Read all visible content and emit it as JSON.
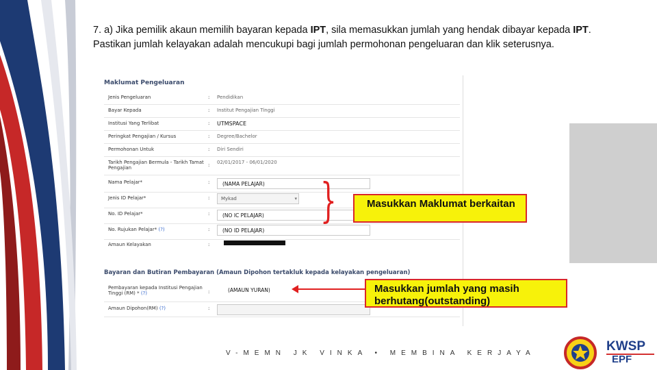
{
  "instruction": {
    "prefix": "7.  a) Jika pemilik akaun memilih bayaran kepada ",
    "b1": "IPT",
    "mid1": ", sila memasukkan jumlah yang hendak dibayar kepada ",
    "b2": "IPT",
    "suffix": ". Pastikan jumlah kelayakan adalah mencukupi bagi jumlah permohonan pengeluaran dan klik seterusnya."
  },
  "form": {
    "section1_title": "Maklumat Pengeluaran",
    "rows": [
      {
        "label": "Jenis Pengeluaran",
        "value": "Pendidikan"
      },
      {
        "label": "Bayar Kepada",
        "value": "Institut Pengajian Tinggi"
      },
      {
        "label": "Institusi Yang Terlibat",
        "value": "UTMSPACE"
      },
      {
        "label": "Peringkat Pengajian / Kursus",
        "value": "Degree/Bachelor"
      },
      {
        "label": "Permohonan Untuk",
        "value": "Diri Sendiri"
      },
      {
        "label": "Tarikh Pengajian Bermula - Tarikh Tamat Pengajian",
        "value": "02/01/2017 - 06/01/2020"
      },
      {
        "label": "Nama Pelajar*",
        "value": "(NAMA PELAJAR)"
      },
      {
        "label": "Jenis ID Pelajar*",
        "value": "Mykad"
      },
      {
        "label": "No. ID Pelajar*",
        "value": "(NO IC PELAJAR)"
      },
      {
        "label": "No. Rujukan Pelajar*",
        "help": "(?)",
        "value": "(NO ID PELAJAR)"
      },
      {
        "label": "Amaun Kelayakan",
        "value": ""
      }
    ],
    "section2_title": "Bayaran dan Butiran Pembayaran (Amaun Dipohon tertakluk kepada kelayakan pengeluaran)",
    "pay_rows": [
      {
        "label": "Pembayaran kepada Institusi Pengajian Tinggi (RM) *",
        "help": "(?)",
        "value": "(AMAUN YURAN)"
      },
      {
        "label": "Amaun Dipohon(RM)",
        "help": "(?)",
        "value": ""
      }
    ]
  },
  "callouts": {
    "box1": "Masukkan Maklumat berkaitan",
    "box2": "Masukkan jumlah yang masih berhutang(outstanding)"
  },
  "footer": {
    "tagline": "V-MEMN JK VINKA  •  MEMBINA KERJAYA"
  },
  "logo": {
    "line1": "KWSP",
    "line2": "EPF",
    "seal": "KWSP"
  },
  "colors": {
    "callout_fill": "#f7f20a",
    "callout_border": "#d9262a",
    "brand": "#1f3f8a"
  }
}
